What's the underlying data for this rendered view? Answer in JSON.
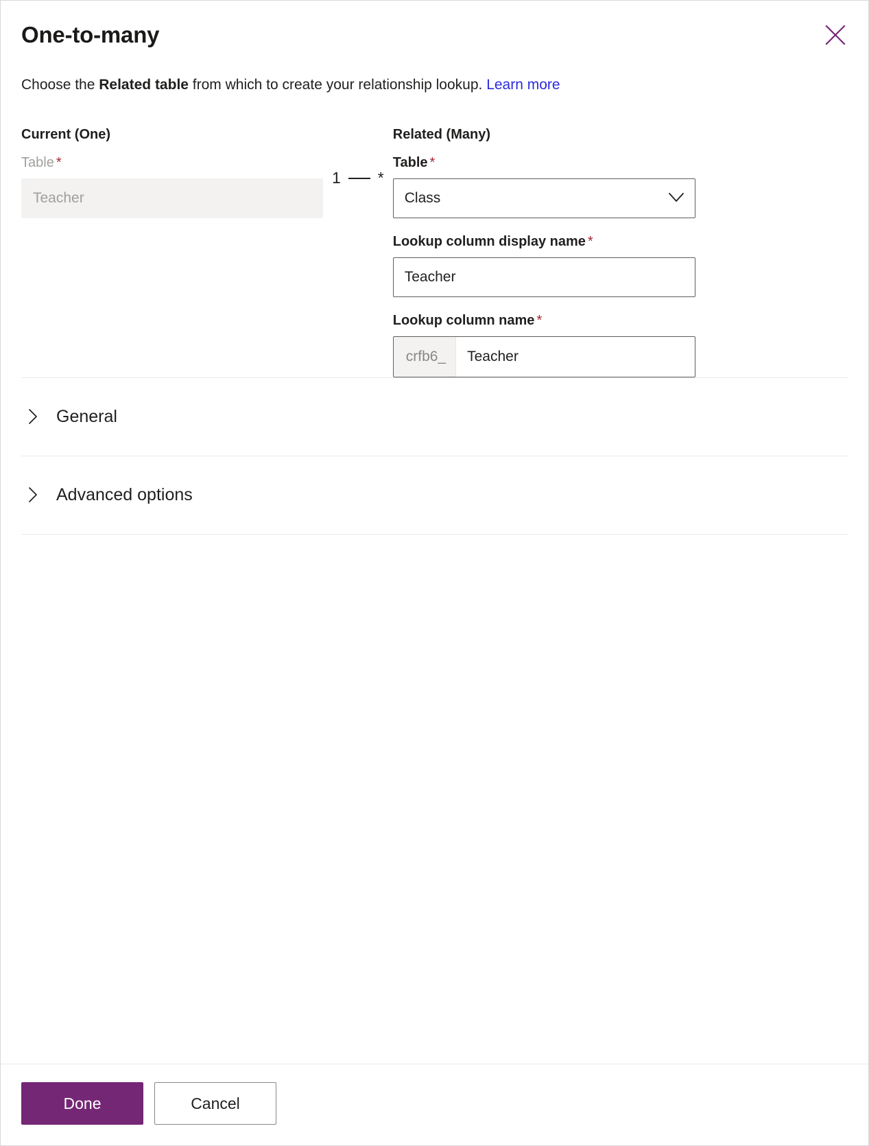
{
  "dialog": {
    "title": "One-to-many",
    "close_icon": "close-icon",
    "description": {
      "lead": "Choose the ",
      "emphasis": "Related table",
      "tail": " from which to create your relationship lookup. ",
      "link_label": "Learn more"
    }
  },
  "current": {
    "section_heading": "Current (One)",
    "table_label": "Table",
    "required_marker": "*",
    "table_value": "Teacher"
  },
  "cardinality": {
    "one": "1",
    "many": "*"
  },
  "related": {
    "section_heading": "Related (Many)",
    "table_label": "Table",
    "required_marker": "*",
    "table_value": "Class",
    "table_chevron_icon": "chevron-down-icon",
    "lookup_display_label": "Lookup column display name",
    "lookup_display_value": "Teacher",
    "lookup_name_label": "Lookup column name",
    "lookup_name_prefix": "crfb6_",
    "lookup_name_value": "Teacher"
  },
  "sections": [
    {
      "label": "General",
      "chevron_icon": "chevron-right-icon"
    },
    {
      "label": "Advanced options",
      "chevron_icon": "chevron-right-icon"
    }
  ],
  "footer": {
    "done_label": "Done",
    "cancel_label": "Cancel"
  },
  "colors": {
    "brand_purple": "#742774",
    "link_blue": "#2b2bdd",
    "required_red": "#a4262c",
    "disabled_bg": "#f3f2f1",
    "border_gray": "#605e5c"
  }
}
